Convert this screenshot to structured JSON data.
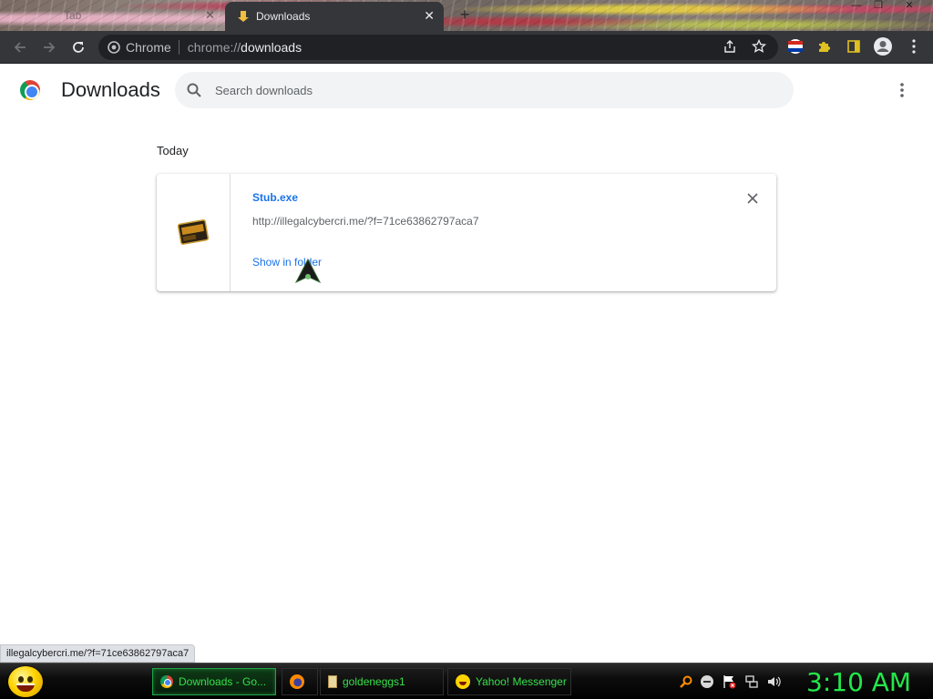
{
  "window": {
    "tabs": [
      {
        "label": "Tab",
        "active": false
      },
      {
        "label": "Downloads",
        "active": true
      }
    ],
    "controls": {
      "minimize": "—",
      "maximize": "❐",
      "close": "✕"
    },
    "new_tab_symbol": "+",
    "tab_close_symbol": "✕"
  },
  "toolbar": {
    "omnibox": {
      "site_name": "Chrome",
      "url_scheme": "chrome://",
      "url_host": "downloads"
    }
  },
  "downloads_page": {
    "title": "Downloads",
    "search": {
      "placeholder": "Search downloads",
      "value": ""
    },
    "section_label": "Today",
    "items": [
      {
        "file_name": "Stub.exe",
        "source_url": "http://illegalcybercri.me/?f=71ce63862797aca7",
        "action_label": "Show in folder"
      }
    ]
  },
  "status_bubble": "illegalcybercri.me/?f=71ce63862797aca7",
  "taskbar": {
    "items": [
      {
        "label": "Downloads - Go...",
        "icon": "chrome-icon",
        "active": true
      },
      {
        "label": "",
        "icon": "firefox-icon",
        "active": false
      },
      {
        "label": "goldeneggs1",
        "icon": "file-icon",
        "active": false
      },
      {
        "label": "Yahoo! Messenger",
        "icon": "yahoo-messenger-icon",
        "active": false
      }
    ],
    "clock": "3:10 AM"
  },
  "colors": {
    "toolbar_bg": "#35363a",
    "link_blue": "#1a73e8",
    "taskbar_green": "#36e04a"
  }
}
